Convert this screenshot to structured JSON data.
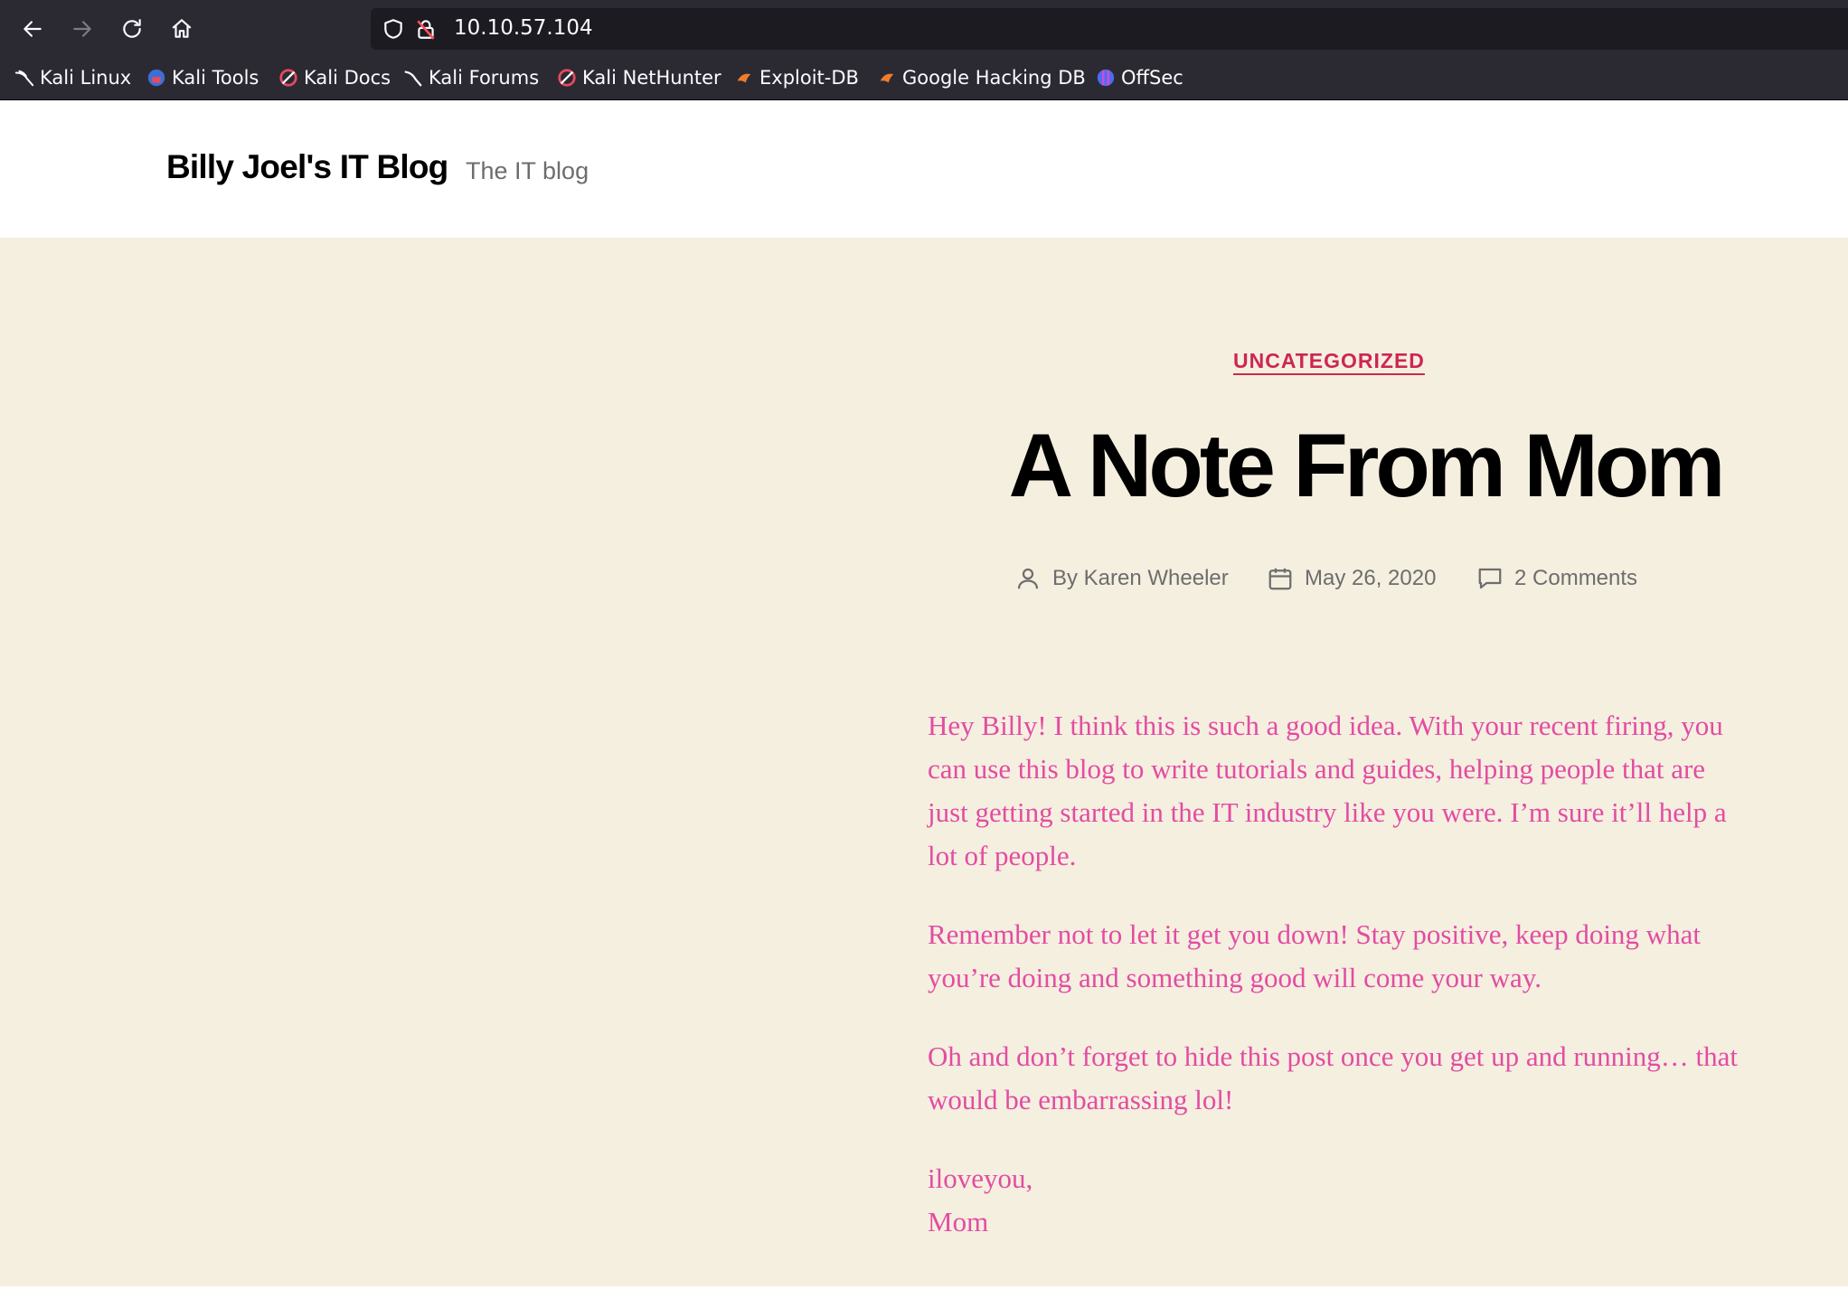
{
  "browser": {
    "url": "10.10.57.104",
    "bookmarks": [
      {
        "label": "Kali Linux",
        "icon": "kali-dragon-icon"
      },
      {
        "label": "Kali Tools",
        "icon": "kali-tools-icon"
      },
      {
        "label": "Kali Docs",
        "icon": "kali-docs-icon"
      },
      {
        "label": "Kali Forums",
        "icon": "kali-forums-icon"
      },
      {
        "label": "Kali NetHunter",
        "icon": "kali-nethunter-icon"
      },
      {
        "label": "Exploit-DB",
        "icon": "exploit-db-icon"
      },
      {
        "label": "Google Hacking DB",
        "icon": "ghdb-icon"
      },
      {
        "label": "OffSec",
        "icon": "offsec-icon"
      }
    ]
  },
  "site": {
    "title": "Billy Joel's IT Blog",
    "description": "The IT blog"
  },
  "post": {
    "category": "UNCATEGORIZED",
    "title": "A Note From Mom",
    "author": "By Karen Wheeler",
    "date": "May 26, 2020",
    "comments": "2 Comments",
    "paragraphs": [
      "Hey Billy!  I think this is such a good idea.  With your recent firing, you can use this blog to write tutorials and guides, helping people that are just getting started in the IT industry like you were.  I’m sure it’ll help a lot of people.",
      "Remember not to let it get you down!  Stay positive, keep doing what you’re doing and something good will come your way.",
      "Oh and don’t forget to hide this post once you get up and running… that would be embarrassing lol!"
    ],
    "signoff_line1": "iloveyou,",
    "signoff_line2": "Mom"
  },
  "colors": {
    "accent": "#cd2653",
    "body_text": "#e34ca2",
    "background": "#f5efe0",
    "chrome": "#2b2a33"
  }
}
